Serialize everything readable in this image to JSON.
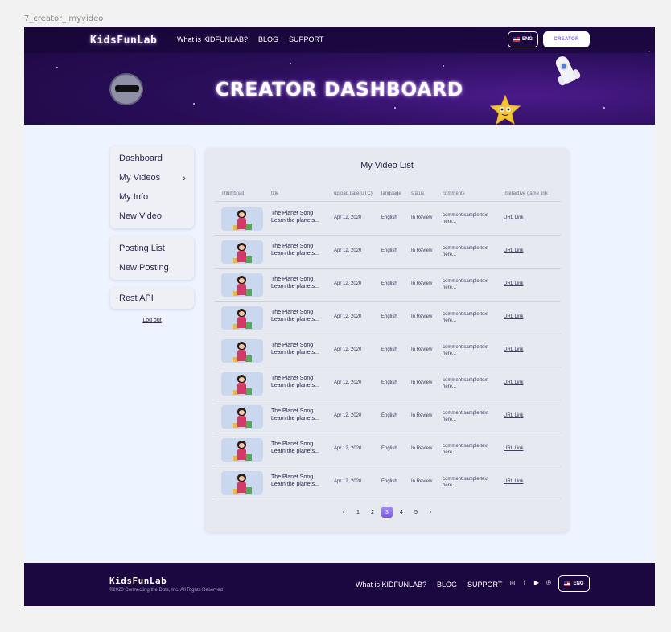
{
  "frame_label": "7_creator_ myvideo",
  "header": {
    "logo": "KidsFunLab",
    "nav": [
      "What is KIDFUNLAB?",
      "BLOG",
      "SUPPORT"
    ],
    "language": "ENG",
    "creator_button": "CREATOR",
    "title": "CREATOR DASHBOARD"
  },
  "sidebar": {
    "group1": [
      "Dashboard",
      "My Videos",
      "My Info",
      "New Video"
    ],
    "group2": [
      "Posting List",
      "New Posting"
    ],
    "group3": [
      "Rest API"
    ],
    "logout": "Log out"
  },
  "main": {
    "title": "My Video List",
    "columns": [
      "Thumbnail",
      "title",
      "upload date(UTC)",
      "language",
      "status",
      "comments",
      "interactive game link"
    ],
    "rows": [
      {
        "title1": "The Planet Song",
        "title2": "Learn the planets...",
        "date": "Apr 12, 2020",
        "language": "English",
        "status": "In Review",
        "comment1": "comment sample text",
        "comment2": "here...",
        "link": "URL Link"
      },
      {
        "title1": "The Planet Song",
        "title2": "Learn the planets...",
        "date": "Apr 12, 2020",
        "language": "English",
        "status": "In Review",
        "comment1": "comment sample text",
        "comment2": "here...",
        "link": "URL Link"
      },
      {
        "title1": "The Planet Song",
        "title2": "Learn the planets...",
        "date": "Apr 12, 2020",
        "language": "English",
        "status": "In Review",
        "comment1": "comment sample text",
        "comment2": "here...",
        "link": "URL Link"
      },
      {
        "title1": "The Planet Song",
        "title2": "Learn the planets...",
        "date": "Apr 12, 2020",
        "language": "English",
        "status": "In Review",
        "comment1": "comment sample text",
        "comment2": "here...",
        "link": "URL Link"
      },
      {
        "title1": "The Planet Song",
        "title2": "Learn the planets...",
        "date": "Apr 12, 2020",
        "language": "English",
        "status": "In Review",
        "comment1": "comment sample text",
        "comment2": "here...",
        "link": "URL Link"
      },
      {
        "title1": "The Planet Song",
        "title2": "Learn the planets...",
        "date": "Apr 12, 2020",
        "language": "English",
        "status": "In Review",
        "comment1": "comment sample text",
        "comment2": "here...",
        "link": "URL Link"
      },
      {
        "title1": "The Planet Song",
        "title2": "Learn the planets...",
        "date": "Apr 12, 2020",
        "language": "English",
        "status": "In Review",
        "comment1": "comment sample text",
        "comment2": "here...",
        "link": "URL Link"
      },
      {
        "title1": "The Planet Song",
        "title2": "Learn the planets...",
        "date": "Apr 12, 2020",
        "language": "English",
        "status": "In Review",
        "comment1": "comment sample text",
        "comment2": "here...",
        "link": "URL Link"
      },
      {
        "title1": "The Planet Song",
        "title2": "Learn the planets...",
        "date": "Apr 12, 2020",
        "language": "English",
        "status": "In Review",
        "comment1": "comment sample text",
        "comment2": "here...",
        "link": "URL Link"
      }
    ],
    "pagination": {
      "prev": "‹",
      "pages": [
        "1",
        "2",
        "3",
        "4",
        "5"
      ],
      "current": "3",
      "next": "›"
    }
  },
  "footer": {
    "logo": "KidsFunLab",
    "copyright": "©2020 Connecting the Dots, Inc. All Rights Reserved",
    "links": [
      "What is KIDFUNLAB?",
      "BLOG",
      "SUPPORT"
    ],
    "social_icons": [
      "instagram-icon",
      "facebook-icon",
      "youtube-icon",
      "pinterest-icon"
    ],
    "language": "ENG"
  },
  "colors": {
    "accent": "#7a5ae0",
    "header_bg": "#2a0e5a",
    "footer_bg": "#1c0840",
    "page_bg": "#eef4ff"
  }
}
